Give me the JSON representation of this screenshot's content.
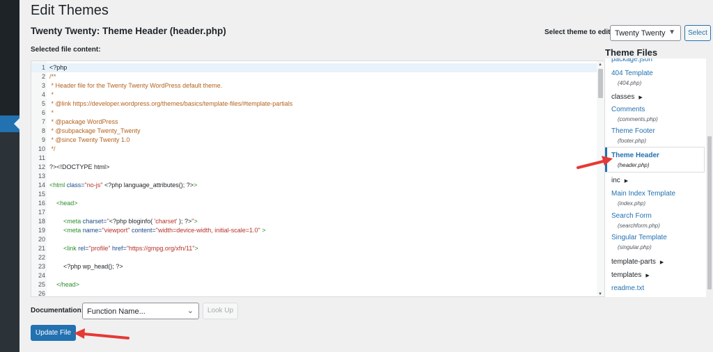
{
  "page": {
    "title": "Edit Themes",
    "file_title": "Twenty Twenty: Theme Header (header.php)",
    "selected_file_label": "Selected file content:"
  },
  "theme_select": {
    "label": "Select theme to edit:",
    "value": "Twenty Twenty",
    "button": "Select"
  },
  "editor": {
    "lines": [
      {
        "n": "1",
        "parts": [
          {
            "c": "php",
            "t": "<?php"
          }
        ]
      },
      {
        "n": "2",
        "parts": [
          {
            "c": "cm",
            "t": "/**"
          }
        ]
      },
      {
        "n": "3",
        "parts": [
          {
            "c": "cm",
            "t": " * Header file for the Twenty Twenty WordPress default theme."
          }
        ]
      },
      {
        "n": "4",
        "parts": [
          {
            "c": "cm",
            "t": " *"
          }
        ]
      },
      {
        "n": "5",
        "parts": [
          {
            "c": "cm",
            "t": " * @link https://developer.wordpress.org/themes/basics/template-files/#template-partials"
          }
        ]
      },
      {
        "n": "6",
        "parts": [
          {
            "c": "cm",
            "t": " *"
          }
        ]
      },
      {
        "n": "7",
        "parts": [
          {
            "c": "cm",
            "t": " * @package WordPress"
          }
        ]
      },
      {
        "n": "8",
        "parts": [
          {
            "c": "cm",
            "t": " * @subpackage Twenty_Twenty"
          }
        ]
      },
      {
        "n": "9",
        "parts": [
          {
            "c": "cm",
            "t": " * @since Twenty Twenty 1.0"
          }
        ]
      },
      {
        "n": "10",
        "parts": [
          {
            "c": "cm",
            "t": " */"
          }
        ]
      },
      {
        "n": "11",
        "parts": []
      },
      {
        "n": "12",
        "parts": [
          {
            "c": "php",
            "t": "?><!DOCTYPE html>"
          }
        ]
      },
      {
        "n": "13",
        "parts": []
      },
      {
        "n": "14",
        "parts": [
          {
            "c": "tg",
            "t": "<html "
          },
          {
            "c": "at",
            "t": "class="
          },
          {
            "c": "st",
            "t": "\"no-js\""
          },
          {
            "c": "php",
            "t": " <?php language_attributes(); ?>"
          },
          {
            "c": "tg",
            "t": ">"
          }
        ]
      },
      {
        "n": "15",
        "parts": []
      },
      {
        "n": "16",
        "parts": [
          {
            "c": "tg",
            "t": "    <head>"
          }
        ]
      },
      {
        "n": "17",
        "parts": []
      },
      {
        "n": "18",
        "parts": [
          {
            "c": "tg",
            "t": "        <meta "
          },
          {
            "c": "at",
            "t": "charset="
          },
          {
            "c": "st",
            "t": "\""
          },
          {
            "c": "php",
            "t": "<?php bloginfo( "
          },
          {
            "c": "st",
            "t": "'charset'"
          },
          {
            "c": "php",
            "t": " ); ?>"
          },
          {
            "c": "st",
            "t": "\""
          },
          {
            "c": "tg",
            "t": ">"
          }
        ]
      },
      {
        "n": "19",
        "parts": [
          {
            "c": "tg",
            "t": "        <meta "
          },
          {
            "c": "at",
            "t": "name="
          },
          {
            "c": "st",
            "t": "\"viewport\""
          },
          {
            "c": "at",
            "t": " content="
          },
          {
            "c": "st",
            "t": "\"width=device-width, initial-scale=1.0\""
          },
          {
            "c": "tg",
            "t": " >"
          }
        ]
      },
      {
        "n": "20",
        "parts": []
      },
      {
        "n": "21",
        "parts": [
          {
            "c": "tg",
            "t": "        <link "
          },
          {
            "c": "at",
            "t": "rel="
          },
          {
            "c": "st",
            "t": "\"profile\""
          },
          {
            "c": "at",
            "t": " href="
          },
          {
            "c": "st",
            "t": "\"https://gmpg.org/xfn/11\""
          },
          {
            "c": "tg",
            "t": ">"
          }
        ]
      },
      {
        "n": "22",
        "parts": []
      },
      {
        "n": "23",
        "parts": [
          {
            "c": "php",
            "t": "        <?php wp_head(); ?>"
          }
        ]
      },
      {
        "n": "24",
        "parts": []
      },
      {
        "n": "25",
        "parts": [
          {
            "c": "tg",
            "t": "    </head>"
          }
        ]
      },
      {
        "n": "26",
        "parts": []
      }
    ]
  },
  "theme_files": {
    "title": "Theme Files",
    "items": [
      {
        "kind": "file",
        "label": "package.json",
        "sub": ""
      },
      {
        "kind": "file",
        "label": "404 Template",
        "sub": "(404.php)"
      },
      {
        "kind": "dir",
        "label": "classes",
        "sub": ""
      },
      {
        "kind": "file",
        "label": "Comments",
        "sub": "(comments.php)"
      },
      {
        "kind": "file",
        "label": "Theme Footer",
        "sub": "(footer.php)"
      },
      {
        "kind": "active",
        "label": "Theme Header",
        "sub": "(header.php)"
      },
      {
        "kind": "dir",
        "label": "inc",
        "sub": ""
      },
      {
        "kind": "file",
        "label": "Main Index Template",
        "sub": "(index.php)"
      },
      {
        "kind": "file",
        "label": "Search Form",
        "sub": "(searchform.php)"
      },
      {
        "kind": "file",
        "label": "Singular Template",
        "sub": "(singular.php)"
      },
      {
        "kind": "dir",
        "label": "template-parts",
        "sub": ""
      },
      {
        "kind": "dir",
        "label": "templates",
        "sub": ""
      },
      {
        "kind": "file",
        "label": "readme.txt",
        "sub": ""
      }
    ]
  },
  "documentation": {
    "label": "Documentation:",
    "select_value": "Function Name...",
    "lookup_button": "Look Up"
  },
  "update_button": "Update File",
  "colors": {
    "accent": "#2271b1",
    "annotation_arrow": "#e53935"
  }
}
